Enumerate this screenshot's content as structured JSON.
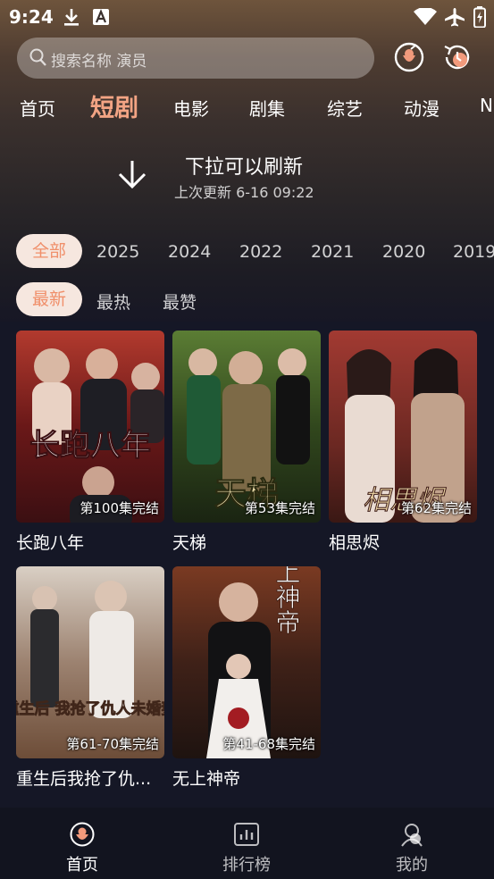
{
  "status_bar": {
    "time": "9:24"
  },
  "search": {
    "placeholder": "搜索名称 演员"
  },
  "tabs": [
    {
      "label": "首页",
      "active": false
    },
    {
      "label": "短剧",
      "active": true
    },
    {
      "label": "电影",
      "active": false
    },
    {
      "label": "剧集",
      "active": false
    },
    {
      "label": "综艺",
      "active": false
    },
    {
      "label": "动漫",
      "active": false
    },
    {
      "label": "N",
      "active": false
    }
  ],
  "refresh": {
    "title": "下拉可以刷新",
    "subtitle": "上次更新 6-16 09:22"
  },
  "year_filters": [
    {
      "label": "全部",
      "active": true
    },
    {
      "label": "2025"
    },
    {
      "label": "2024"
    },
    {
      "label": "2022"
    },
    {
      "label": "2021"
    },
    {
      "label": "2020"
    },
    {
      "label": "2019"
    }
  ],
  "sort_filters": [
    {
      "label": "最新",
      "active": true
    },
    {
      "label": "最热"
    },
    {
      "label": "最赞"
    }
  ],
  "cards": [
    {
      "title": "长跑八年",
      "episodes": "第100集完结",
      "poster_text": "长跑八年"
    },
    {
      "title": "天梯",
      "episodes": "第53集完结",
      "poster_text": "天梯"
    },
    {
      "title": "相思烬",
      "episodes": "第62集完结",
      "poster_text": "相思烬"
    },
    {
      "title": "重生后我抢了仇...",
      "episodes": "第61-70集完结",
      "poster_text": "重生后 我抢了仇人未婚妻"
    },
    {
      "title": "无上神帝",
      "episodes": "第41-68集完结",
      "poster_text": "无上神帝"
    }
  ],
  "bottom_nav": [
    {
      "label": "首页",
      "icon": "home-icon",
      "active": true
    },
    {
      "label": "排行榜",
      "icon": "ranking-icon",
      "active": false
    },
    {
      "label": "我的",
      "icon": "profile-icon",
      "active": false
    }
  ],
  "colors": {
    "accent": "#f08f6a",
    "active_tab": "#f3a484",
    "background": "#151726"
  }
}
